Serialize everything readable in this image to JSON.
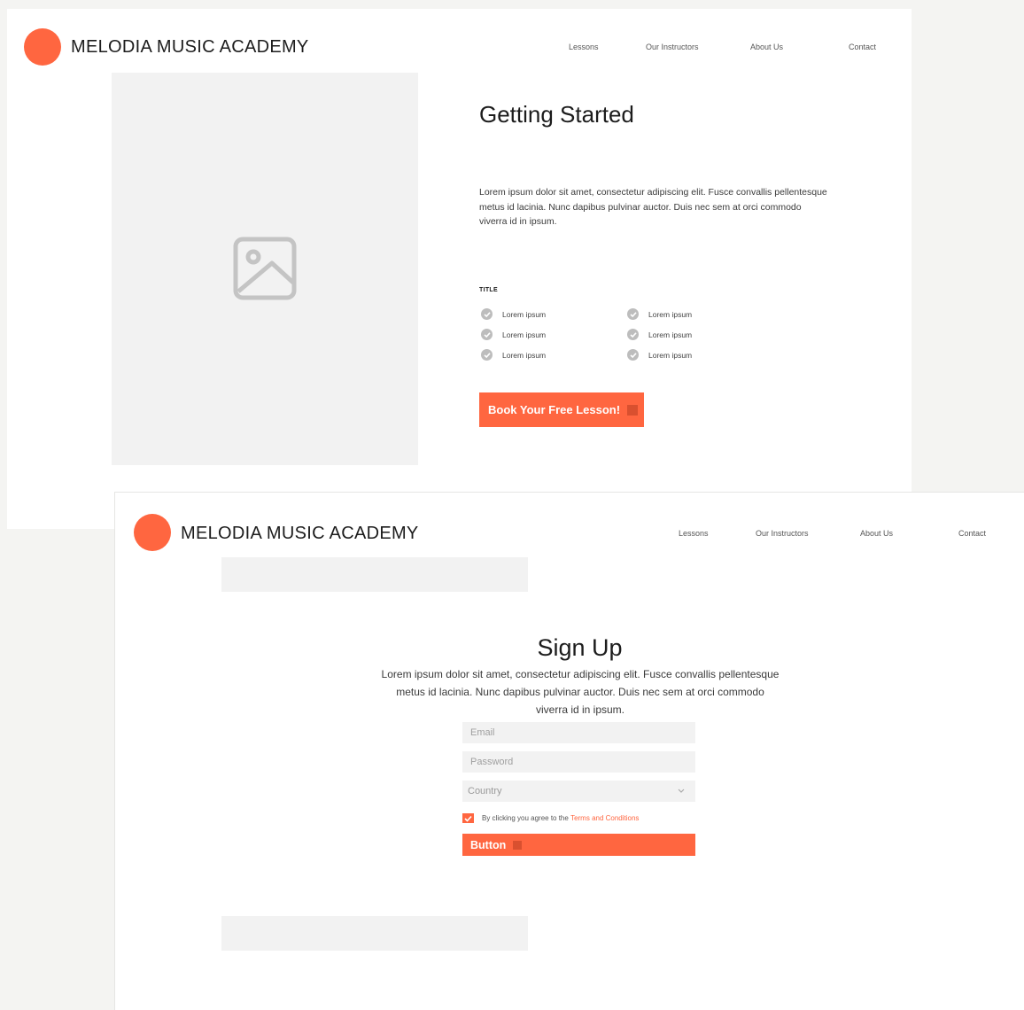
{
  "colors": {
    "accent": "#ff6640",
    "placeholder_bg": "#f2f2f2",
    "check_gray": "#bdbdbd"
  },
  "nav": {
    "items": [
      "Lessons",
      "Our Instructors",
      "About Us",
      "Contact"
    ]
  },
  "page1": {
    "brand": "MELODIA MUSIC ACADEMY",
    "heading": "Getting Started",
    "paragraph": "Lorem ipsum dolor sit amet, consectetur adipiscing elit. Fusce convallis pellentesque metus id lacinia. Nunc dapibus pulvinar auctor. Duis nec sem at orci commodo viverra id in ipsum.",
    "list_title": "TITLE",
    "checklist": [
      "Lorem ipsum",
      "Lorem ipsum",
      "Lorem ipsum",
      "Lorem ipsum",
      "Lorem ipsum",
      "Lorem ipsum"
    ],
    "cta_label": "Book Your Free Lesson!",
    "image_icon": "image-placeholder-icon"
  },
  "page2": {
    "brand": "MELODIA MUSIC ACADEMY",
    "heading": "Sign Up",
    "paragraph": "Lorem ipsum dolor sit amet, consectetur adipiscing elit. Fusce convallis pellentesque metus id lacinia. Nunc dapibus pulvinar auctor. Duis nec sem at orci commodo viverra id in ipsum.",
    "form": {
      "email_placeholder": "Email",
      "password_placeholder": "Password",
      "country_placeholder": "Country",
      "agree_text": "By clicking you agree to the ",
      "terms_link": "Terms and Conditions",
      "agree_checked": true,
      "button_label": "Button"
    }
  }
}
